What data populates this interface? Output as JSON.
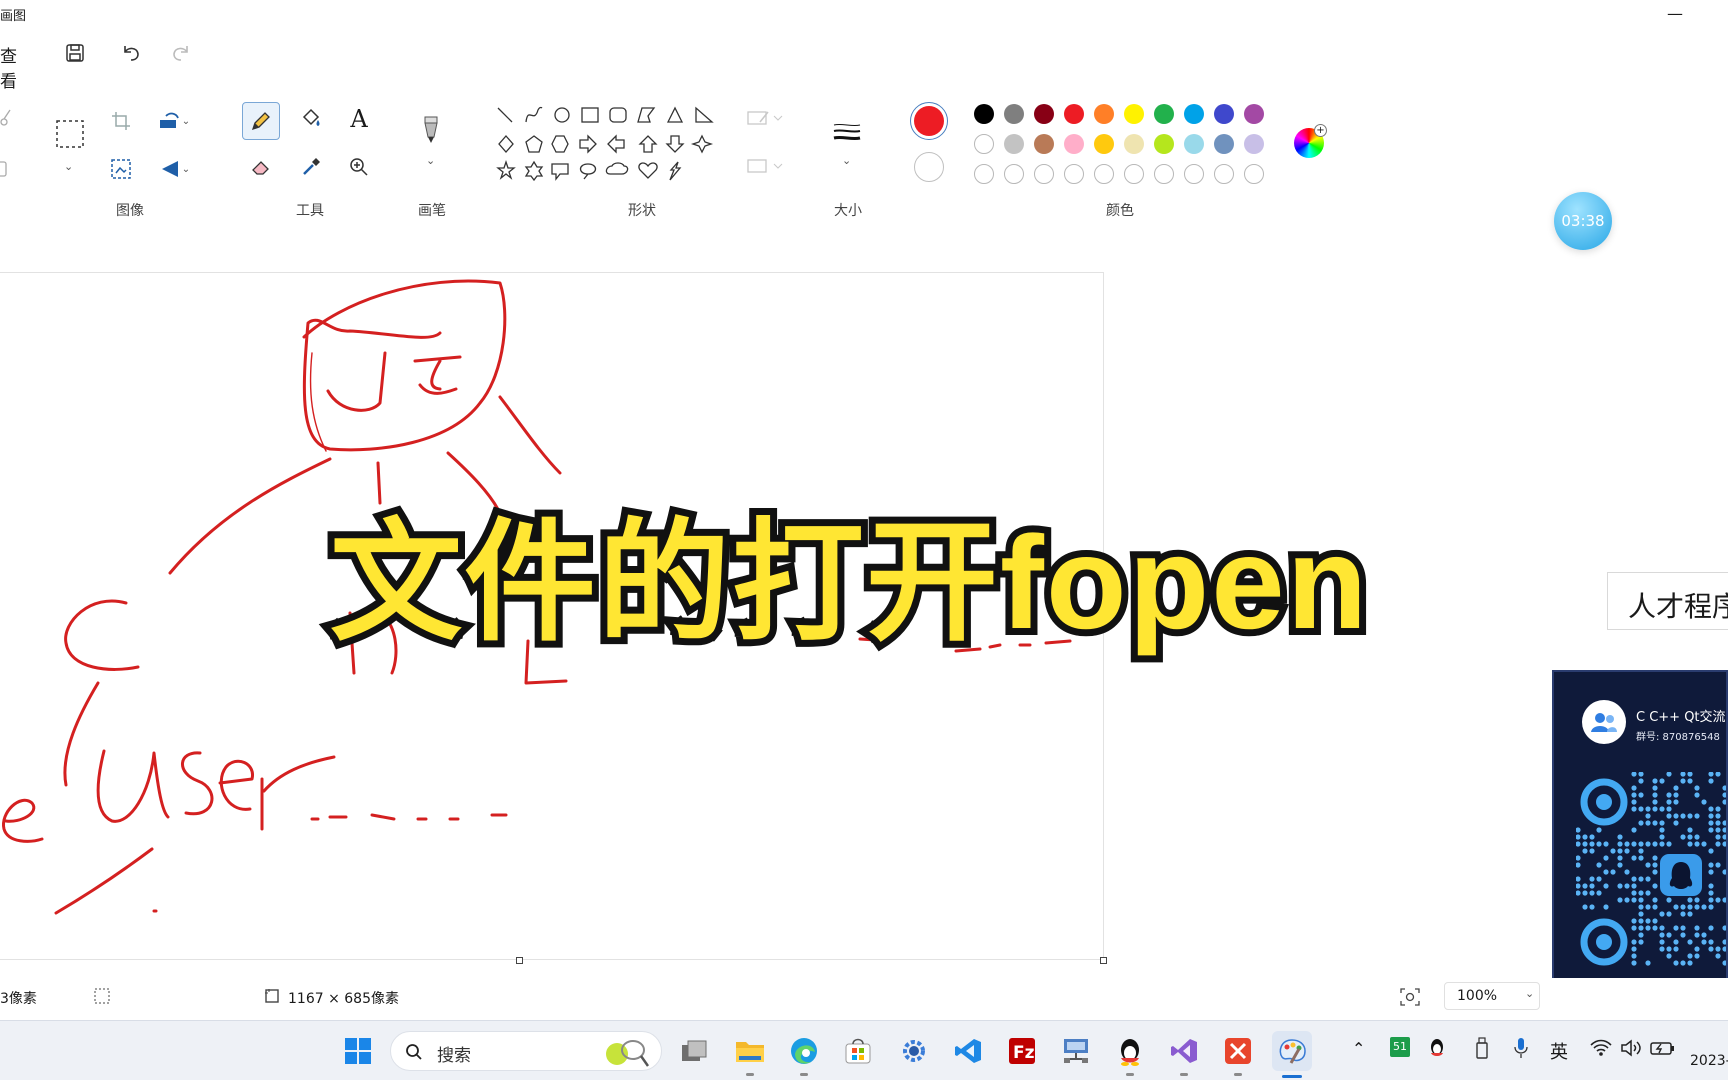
{
  "window": {
    "title": "画图",
    "minimize_glyph": "—"
  },
  "menu": {
    "view": "查看"
  },
  "ribbon": {
    "groups": {
      "image": "图像",
      "tools": "工具",
      "brushes": "画笔",
      "shapes": "形状",
      "size": "大小",
      "colors": "颜色"
    }
  },
  "colors": {
    "primary": "#ed1c24",
    "secondary": "#ffffff",
    "palette_row1": [
      "#000000",
      "#7f7f7f",
      "#880015",
      "#ed1c24",
      "#ff7f27",
      "#fff200",
      "#22b14c",
      "#00a2e8",
      "#3f48cc",
      "#a349a4"
    ],
    "palette_row2": [
      "#ffffff",
      "#c3c3c3",
      "#b97a57",
      "#ffaec9",
      "#ffc90e",
      "#efe4b0",
      "#b5e61d",
      "#99d9ea",
      "#7092be",
      "#c8bfe7"
    ]
  },
  "canvas": {
    "stroke_color": "#d42020"
  },
  "overlay": {
    "title": "文件的打开fopen"
  },
  "timer": {
    "text": "03:38"
  },
  "side_banner": {
    "text": "人才程序"
  },
  "qq_card": {
    "group_name": "C C++ Qt交流群",
    "group_id": "群号: 870876548"
  },
  "status": {
    "cursor_pos": "3像素",
    "canvas_size": "1167 × 685像素",
    "zoom": "100%"
  },
  "taskbar": {
    "search_placeholder": "搜索",
    "tray": {
      "ime": "英",
      "badge": "51",
      "date": "2023-"
    }
  }
}
